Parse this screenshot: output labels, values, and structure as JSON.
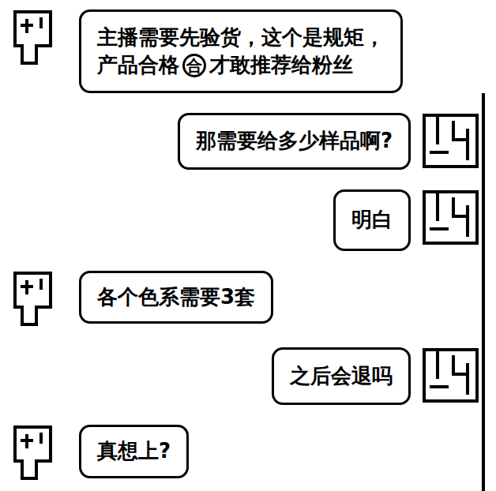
{
  "messages": [
    {
      "side": "left",
      "lines": [
        [
          {
            "kind": "plain",
            "text": "主播需要先验货，这个是规矩，"
          }
        ],
        [
          {
            "kind": "plain",
            "text": "产品合格"
          },
          {
            "kind": "badge",
            "text": "合"
          },
          {
            "kind": "plain",
            "text": "才敢推荐给粉丝"
          }
        ]
      ]
    },
    {
      "side": "right",
      "lines": [
        [
          {
            "kind": "plain",
            "text": "那需要给多少样品啊?"
          }
        ]
      ]
    },
    {
      "side": "right",
      "lines": [
        [
          {
            "kind": "plain",
            "text": "明白"
          }
        ]
      ]
    },
    {
      "side": "left",
      "lines": [
        [
          {
            "kind": "plain",
            "text": "各个色系需要3套"
          }
        ]
      ]
    },
    {
      "side": "right",
      "lines": [
        [
          {
            "kind": "plain",
            "text": "之后会退吗"
          }
        ]
      ]
    },
    {
      "side": "left",
      "lines": [
        [
          {
            "kind": "plain",
            "text": "真想上?"
          }
        ]
      ]
    }
  ]
}
